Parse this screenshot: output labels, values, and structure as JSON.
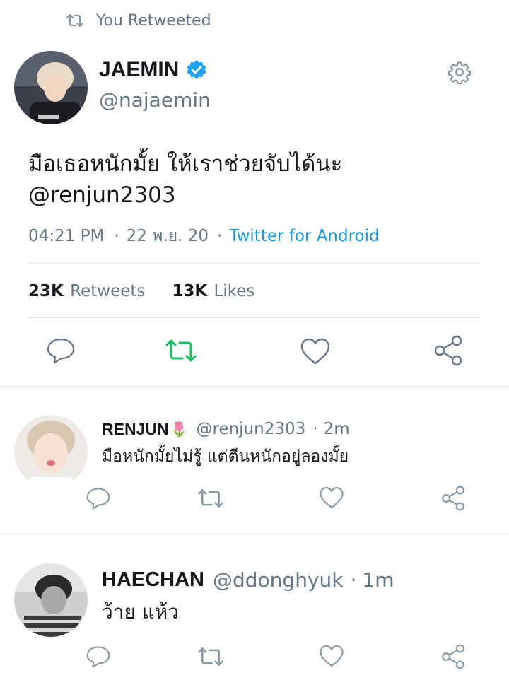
{
  "social_context": {
    "text": "You Retweeted",
    "icon": "retweet-icon"
  },
  "main_tweet": {
    "display_name": "JAEMIN",
    "verified": true,
    "handle": "@najaemin",
    "text_line1": "มือเธอหนักมั้ย ให้เราช่วยจับได้นะ",
    "text_line2": "@renjun2303",
    "time": "04:21 PM",
    "sep1": "·",
    "date": "22 พ.ย. 20",
    "sep2": "·",
    "source": "Twitter for Android",
    "retweets_count": "23K",
    "retweets_label": "Retweets",
    "likes_count": "13K",
    "likes_label": "Likes",
    "retweeted_by_user": true
  },
  "replies": [
    {
      "display_name": "RENJUN",
      "emoji": "🌷",
      "handle": "@renjun2303",
      "sep": "·",
      "time": "2m",
      "text": "มือหนักมั้ยไม่รู้ แต่ตีนหนักอยู่ลองมั้ย"
    },
    {
      "display_name": "HAECHAN",
      "emoji": "",
      "handle": "@ddonghyuk",
      "sep": "·",
      "time": "1m",
      "text": "ว้าย แห้ว"
    }
  ],
  "colors": {
    "text": "#14171a",
    "muted": "#657786",
    "link": "#1b95e0",
    "retweet_active": "#17bf63",
    "verified": "#1da1f2",
    "divider": "#e1e8ed"
  }
}
